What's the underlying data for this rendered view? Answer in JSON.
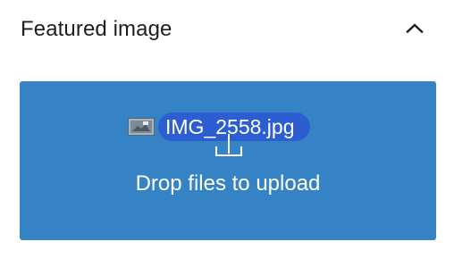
{
  "panel": {
    "title": "Featured image",
    "toggle_icon": "chevron-up-icon"
  },
  "dropzone": {
    "message": "Drop files to upload",
    "upload_icon": "upload-icon",
    "background_color": "#3582c4"
  },
  "dragged_file": {
    "name": "IMG_2558.jpg",
    "thumbnail_icon": "image-thumbnail-icon",
    "pill_color": "#2c5ed1"
  }
}
